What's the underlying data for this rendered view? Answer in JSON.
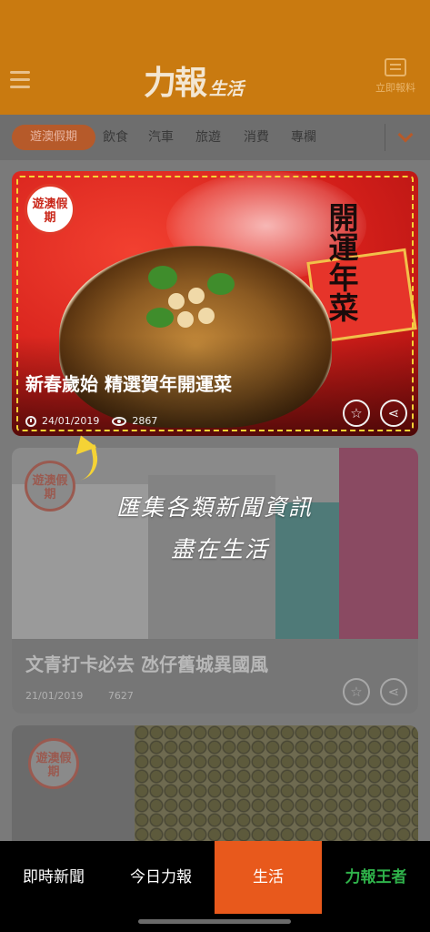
{
  "header": {
    "logo_brand": "力報",
    "logo_section": "生活",
    "report_label": "立即報料",
    "icons": [
      "hamburger-menu-icon",
      "report-icon"
    ]
  },
  "categories": {
    "active": "遊澳假期",
    "items": [
      "飲食",
      "汽車",
      "旅遊",
      "消費",
      "專欄"
    ],
    "expand_icon": "chevron-down-icon"
  },
  "feed": {
    "featured": {
      "badge": "遊澳假期",
      "poster_text": "開運年菜",
      "title": "新春歲始 精選賀年開運菜",
      "date": "24/01/2019",
      "views": "2867"
    },
    "card2": {
      "badge": "遊澳假期",
      "title": "文青打卡必去 氹仔舊城異國風",
      "date": "21/01/2019",
      "views": "7627"
    },
    "card3": {
      "badge": "遊澳假期"
    }
  },
  "overlay": {
    "line1": "匯集各類新聞資訊",
    "line2": "盡在生活"
  },
  "tabbar": {
    "tabs": [
      "即時新聞",
      "今日力報",
      "生活"
    ],
    "active": "生活",
    "brand_left": "力報",
    "brand_right": "王者"
  },
  "colors": {
    "header": "#c97a10",
    "active_tab": "#e8591c",
    "highlight": "#f5d335"
  }
}
